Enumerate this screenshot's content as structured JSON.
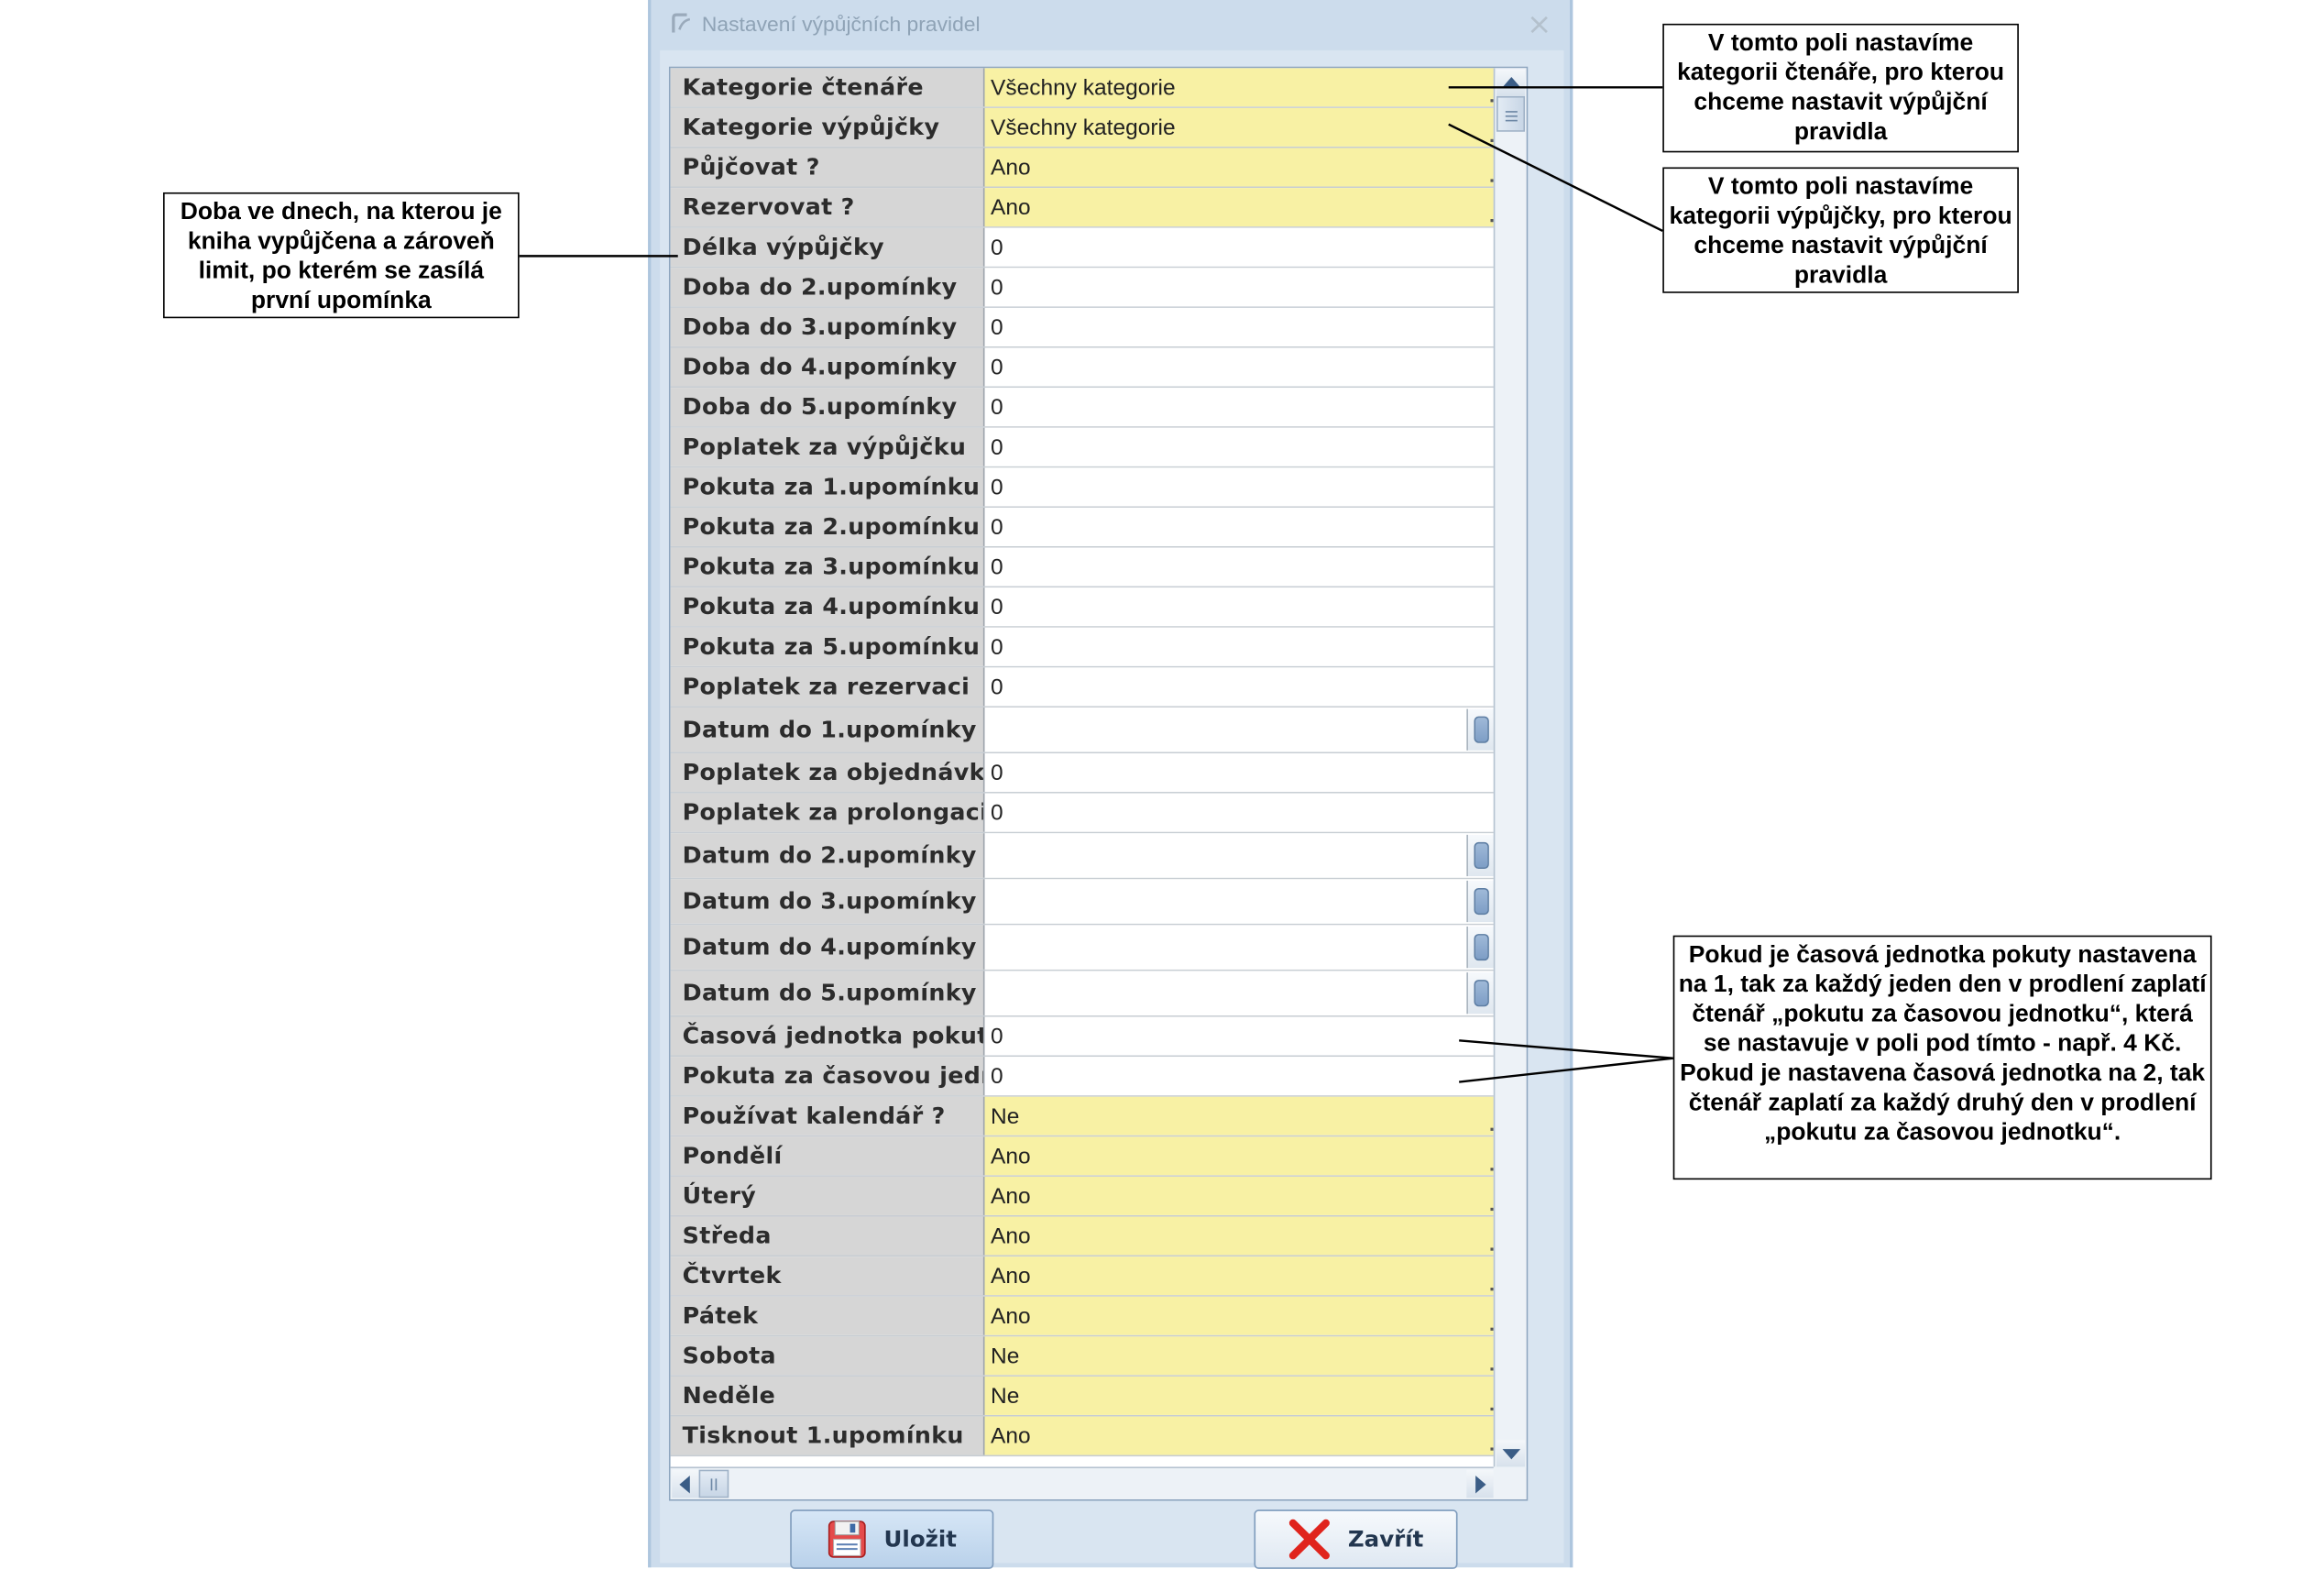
{
  "dialog": {
    "title": "Nastavení výpůjčních pravidel",
    "close_glyph": "×"
  },
  "rows": [
    {
      "label": "Kategorie čtenáře",
      "value": "Všechny kategorie",
      "kind": "dropdown"
    },
    {
      "label": "Kategorie výpůjčky",
      "value": "Všechny kategorie",
      "kind": "dropdown"
    },
    {
      "label": "Půjčovat ?",
      "value": "Ano",
      "kind": "dropdown"
    },
    {
      "label": "Rezervovat ?",
      "value": "Ano",
      "kind": "dropdown"
    },
    {
      "label": "Délka výpůjčky",
      "value": "0",
      "kind": "text"
    },
    {
      "label": "Doba do 2.upomínky",
      "value": "0",
      "kind": "text"
    },
    {
      "label": "Doba do 3.upomínky",
      "value": "0",
      "kind": "text"
    },
    {
      "label": "Doba do 4.upomínky",
      "value": "0",
      "kind": "text"
    },
    {
      "label": "Doba do 5.upomínky",
      "value": "0",
      "kind": "text"
    },
    {
      "label": "Poplatek za výpůjčku",
      "value": "0",
      "kind": "text"
    },
    {
      "label": "Pokuta za 1.upomínku",
      "value": "0",
      "kind": "text"
    },
    {
      "label": "Pokuta za 2.upomínku",
      "value": "0",
      "kind": "text"
    },
    {
      "label": "Pokuta za 3.upomínku",
      "value": "0",
      "kind": "text"
    },
    {
      "label": "Pokuta za 4.upomínku",
      "value": "0",
      "kind": "text"
    },
    {
      "label": "Pokuta za 5.upomínku",
      "value": "0",
      "kind": "text"
    },
    {
      "label": "Poplatek za rezervaci",
      "value": "0",
      "kind": "text"
    },
    {
      "label": "Datum do 1.upomínky",
      "value": "",
      "kind": "date"
    },
    {
      "label": "Poplatek za objednávku",
      "value": "0",
      "kind": "text"
    },
    {
      "label": "Poplatek za prolongaci",
      "value": "0",
      "kind": "text"
    },
    {
      "label": "Datum do 2.upomínky",
      "value": "",
      "kind": "date"
    },
    {
      "label": "Datum do 3.upomínky",
      "value": "",
      "kind": "date"
    },
    {
      "label": "Datum do 4.upomínky",
      "value": "",
      "kind": "date"
    },
    {
      "label": "Datum do 5.upomínky",
      "value": "",
      "kind": "date"
    },
    {
      "label": "Časová jednotka pokuty",
      "value": "0",
      "kind": "text"
    },
    {
      "label": "Pokuta za časovou jednotku",
      "value": "0",
      "kind": "text"
    },
    {
      "label": "Používat kalendář ?",
      "value": "Ne",
      "kind": "dropdown"
    },
    {
      "label": "Pondělí",
      "value": "Ano",
      "kind": "dropdown"
    },
    {
      "label": "Úterý",
      "value": "Ano",
      "kind": "dropdown"
    },
    {
      "label": "Středa",
      "value": "Ano",
      "kind": "dropdown"
    },
    {
      "label": "Čtvrtek",
      "value": "Ano",
      "kind": "dropdown"
    },
    {
      "label": "Pátek",
      "value": "Ano",
      "kind": "dropdown"
    },
    {
      "label": "Sobota",
      "value": "Ne",
      "kind": "dropdown"
    },
    {
      "label": "Neděle",
      "value": "Ne",
      "kind": "dropdown"
    },
    {
      "label": "Tisknout 1.upomínku",
      "value": "Ano",
      "kind": "dropdown"
    }
  ],
  "buttons": {
    "save_label": "Uložit",
    "close_label": "Zavřít"
  },
  "callouts": {
    "reader_category": "V tomto poli nastavíme kategorii čtenáře, pro kterou chceme nastavit výpůjční pravidla",
    "loan_category": "V tomto poli nastavíme kategorii výpůjčky, pro kterou chceme nastavit výpůjční pravidla",
    "loan_length": "Doba ve dnech, na kterou je kniha vypůjčena a zároveň limit, po kterém se zasílá první upomínka",
    "time_unit": "Pokud je časová jednotka pokuty nastavena na 1, tak za každý jeden den v prodlení zaplatí čtenář „pokutu za časovou jednotku“, která se nastavuje v poli pod tímto - např. 4 Kč. Pokud je nastavena časová jednotka na 2, tak čtenář zaplatí za každý druhý den v prodlení „pokutu za časovou jednotku“."
  },
  "icons": {
    "app": "app-logo-icon",
    "save": "floppy-disk-icon",
    "close": "red-x-icon",
    "date": "calendar-picker-icon"
  },
  "colors": {
    "dropdown_bg": "#f8f1a4",
    "label_bg": "#d6d6d6",
    "window_frame": "#ccdcec",
    "close_x": "#e0241d"
  }
}
